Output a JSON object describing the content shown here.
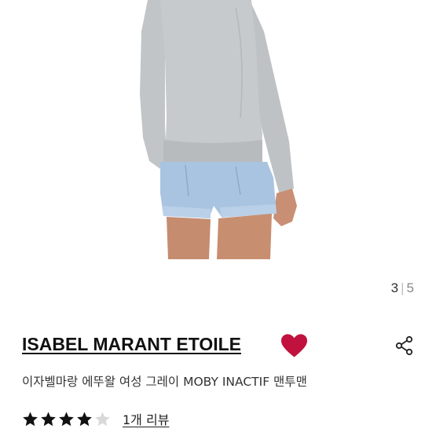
{
  "gallery": {
    "current": "3",
    "separator": "|",
    "total": "5"
  },
  "product": {
    "brand": "ISABEL MARANT ETOILE",
    "title": "이자벨마랑 에뚜왈 여성 그레이 MOBY INACTIF 맨투맨",
    "rating_stars": 4,
    "rating_max": 5,
    "review_link": "1개 리뷰"
  },
  "icons": {
    "wishlist": "heart-icon",
    "share": "share-icon",
    "star": "star-icon"
  },
  "colors": {
    "heart": "#c0123c",
    "star_filled": "#111111",
    "star_empty": "#d9d9d9",
    "sweatshirt": "#c4c7ca",
    "shorts": "#a9c4e0"
  }
}
